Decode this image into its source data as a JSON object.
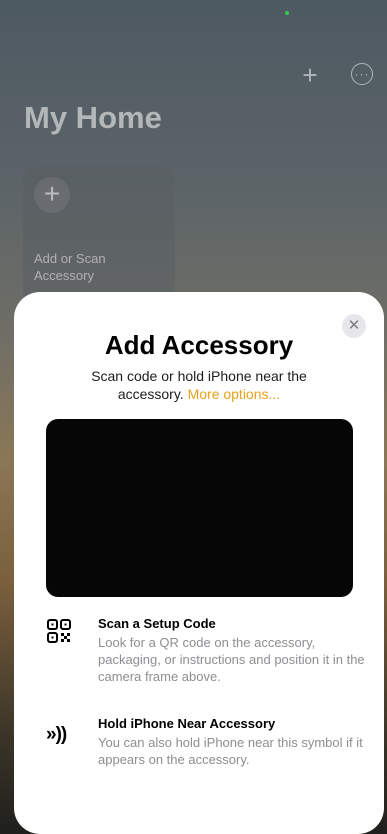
{
  "background": {
    "title": "My Home",
    "icons": {
      "add": "plus-icon",
      "more": "ellipsis-circle-icon"
    },
    "add_tile": {
      "icon": "plus-icon",
      "label": "Add or Scan Accessory"
    }
  },
  "sheet": {
    "close_icon": "xmark-icon",
    "close_glyph": "✕",
    "title": "Add Accessory",
    "subtitle": "Scan code or hold iPhone near the accessory.",
    "more_options": "More options...",
    "options": [
      {
        "icon": "qr-code-icon",
        "title": "Scan a Setup Code",
        "description": "Look for a QR code on the accessory, packaging, or instructions and position it in the camera frame above."
      },
      {
        "icon": "nfc-icon",
        "title": "Hold iPhone Near Accessory",
        "description": "You can also hold iPhone near this symbol if it appears on the accessory."
      }
    ]
  },
  "colors": {
    "link": "#e7a21f",
    "secondary_text": "#8e8e93",
    "camera": "#060606"
  }
}
